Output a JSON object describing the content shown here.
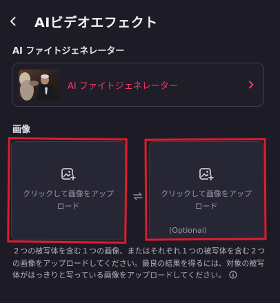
{
  "header": {
    "back_icon": "chevron-left-icon",
    "title": "AIビデオエフェクト"
  },
  "effect_section": {
    "label": "AI ファイトジェネレーター",
    "selected_effect": "AI ファイトジェネレーター",
    "thumbnail": "fight-scene-thumbnail",
    "chevron_icon": "chevron-right-icon",
    "accent_color": "#f23a63"
  },
  "image_section": {
    "label": "画像",
    "upload_1": {
      "icon": "image-add-icon",
      "text": "クリックして画像をアップロード"
    },
    "swap_icon": "swap-icon",
    "upload_2": {
      "icon": "image-add-icon",
      "text": "クリックして画像をアップロード",
      "optional_label": "(Optional)"
    }
  },
  "help_text": "２つの被写体を含む１つの画像、またはそれぞれ１つの被写体を含む２つの画像をアップロードしてください。最良の結果を得るには、対象の被写体がはっきりと写っている画像をアップロードしてください。",
  "info_icon": "info-icon",
  "highlight_color": "#e01b2f"
}
